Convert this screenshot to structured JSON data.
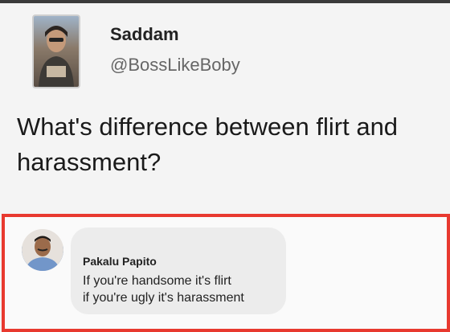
{
  "tweet": {
    "author_name": "Saddam",
    "author_handle": "@BossLikeBoby",
    "text": "What's difference between flirt and harassment?"
  },
  "reply": {
    "author_name": "Pakalu Papito",
    "lines": [
      "If you're handsome it's flirt",
      "if you're ugly it's harassment"
    ]
  },
  "colors": {
    "highlight_border": "#e8392f",
    "bubble": "#ececec"
  }
}
